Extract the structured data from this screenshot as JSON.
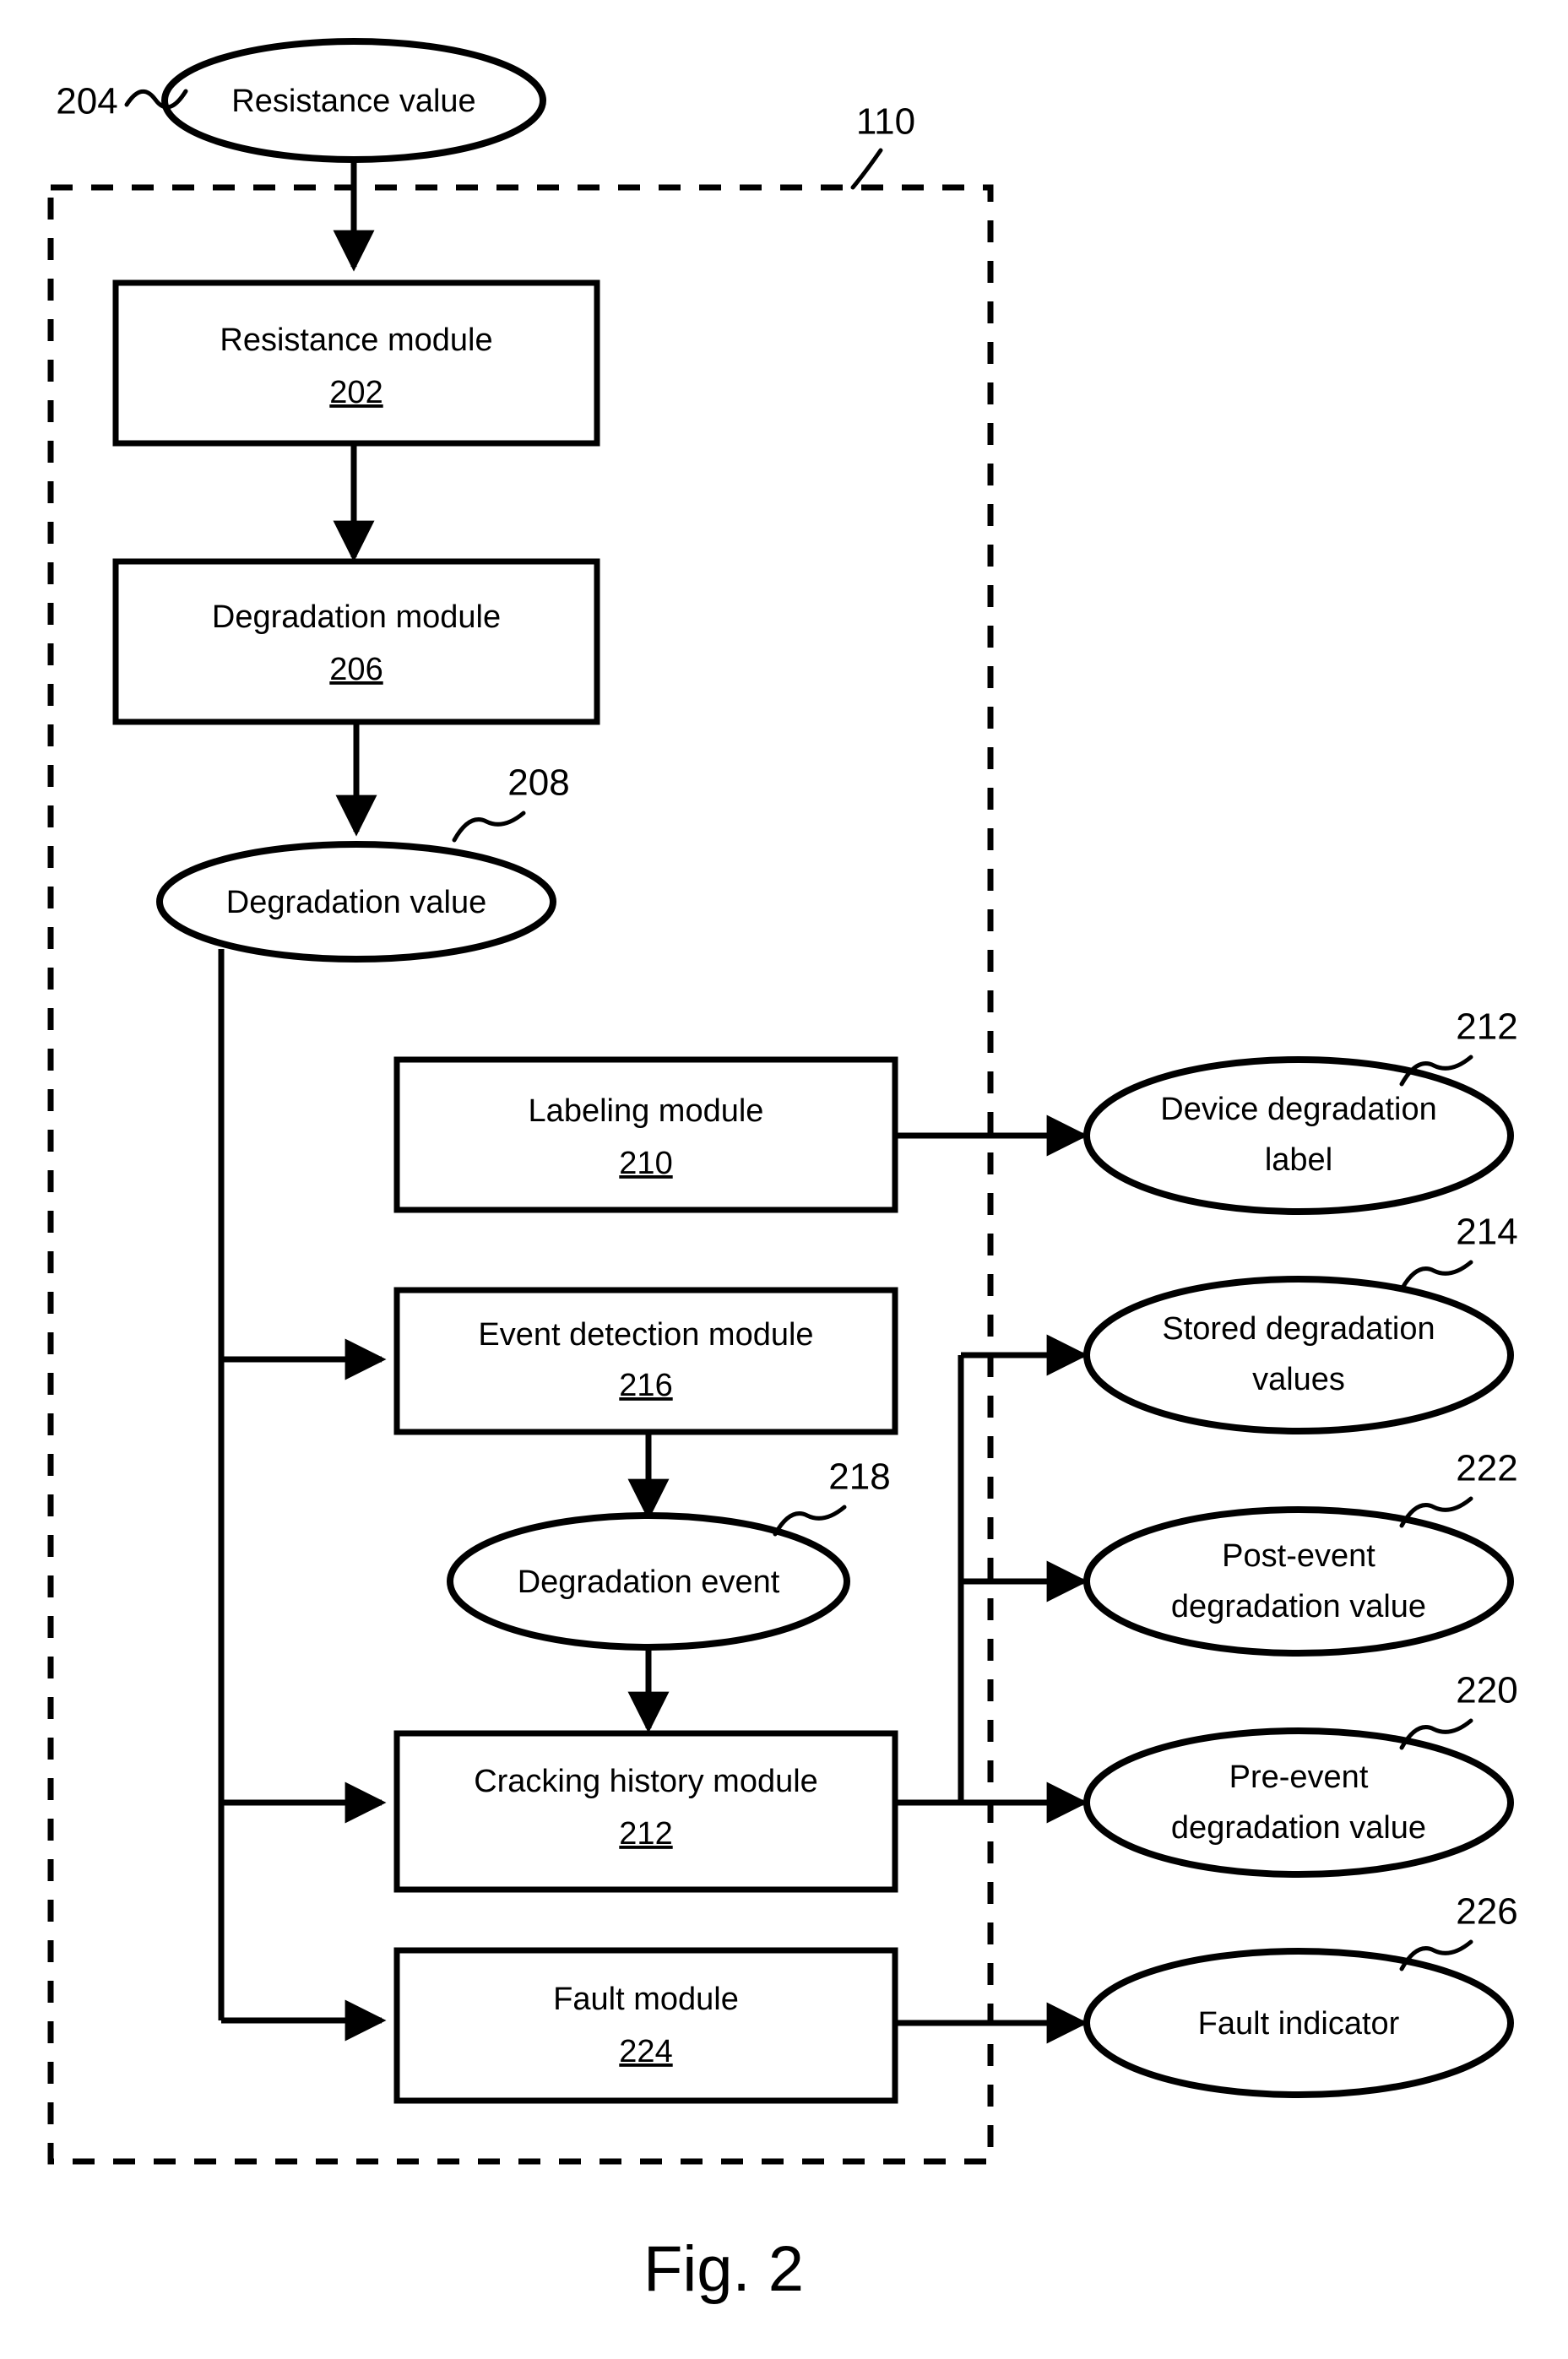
{
  "figure": {
    "caption": "Fig. 2",
    "system_ref": "110"
  },
  "boundary": {
    "label": "110",
    "style": "dashed"
  },
  "inputs": [
    {
      "id": "resistance-value",
      "label": "Resistance value",
      "ref": "204",
      "shape": "ellipse"
    }
  ],
  "modules": [
    {
      "id": "resistance-module",
      "label": "Resistance module",
      "ref": "202",
      "shape": "rect"
    },
    {
      "id": "degradation-module",
      "label": "Degradation module",
      "ref": "206",
      "shape": "rect"
    },
    {
      "id": "labeling-module",
      "label": "Labeling module",
      "ref": "210",
      "shape": "rect"
    },
    {
      "id": "event-detection-module",
      "label": "Event detection module",
      "ref": "216",
      "shape": "rect"
    },
    {
      "id": "cracking-history-module",
      "label": "Cracking history module",
      "ref": "212",
      "shape": "rect"
    },
    {
      "id": "fault-module",
      "label": "Fault module",
      "ref": "224",
      "shape": "rect"
    }
  ],
  "intermediates": [
    {
      "id": "degradation-value",
      "label": "Degradation value",
      "ref": "208",
      "shape": "ellipse"
    },
    {
      "id": "degradation-event",
      "label": "Degradation event",
      "ref": "218",
      "shape": "ellipse"
    }
  ],
  "outputs": [
    {
      "id": "device-degradation-label",
      "label_line1": "Device degradation",
      "label_line2": "label",
      "ref": "212",
      "shape": "ellipse"
    },
    {
      "id": "stored-degradation-values",
      "label_line1": "Stored degradation",
      "label_line2": "values",
      "ref": "214",
      "shape": "ellipse"
    },
    {
      "id": "post-event-degradation-value",
      "label_line1": "Post-event",
      "label_line2": "degradation value",
      "ref": "222",
      "shape": "ellipse"
    },
    {
      "id": "pre-event-degradation-value",
      "label_line1": "Pre-event",
      "label_line2": "degradation value",
      "ref": "220",
      "shape": "ellipse"
    },
    {
      "id": "fault-indicator",
      "label_line1": "Fault indicator",
      "label_line2": "",
      "ref": "226",
      "shape": "ellipse"
    }
  ],
  "colors": {
    "stroke": "#000000",
    "fill": "#ffffff"
  }
}
